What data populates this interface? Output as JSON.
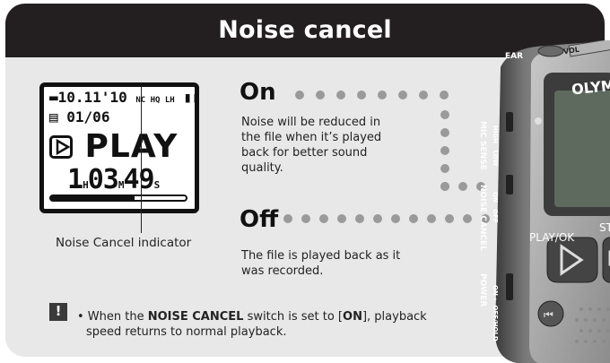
{
  "title": "Noise cancel",
  "display": {
    "date": "10.11'10",
    "status_icons": "NC HQ LH",
    "file_counter": "01/06",
    "mode": "PLAY",
    "time_h": "1",
    "time_h_unit": "H",
    "time_m": "03",
    "time_m_unit": "M",
    "time_s": "49",
    "time_s_unit": "S",
    "progress_fraction": 0.62
  },
  "indicator_label": "Noise Cancel indicator",
  "on_section": {
    "heading": "On",
    "description_lines": [
      "Noise will be reduced in",
      "the file when it’s played",
      "back for better sound",
      "quality."
    ]
  },
  "off_section": {
    "heading": "Off",
    "description_lines": [
      "The file is played back as it",
      "was recorded."
    ]
  },
  "note": {
    "icon": "!",
    "prefix": "• When the ",
    "switch_name": "NOISE CANCEL",
    "middle": " switch is set to [",
    "setting": "ON",
    "suffix_line1": "], playback",
    "line2": "speed returns to normal playback."
  },
  "device": {
    "brand_partial": "OLYM",
    "ear_label": "EAR",
    "vol_label": "VOL",
    "mic_sense_label": "MIC SENSE",
    "mic_sense_high": "HIGH",
    "mic_sense_low": "LOW",
    "noise_cancel_label": "NOISE CANCEL",
    "noise_cancel_on": "ON",
    "noise_cancel_off": "OFF",
    "power_label": "POWER",
    "power_positions": "ON ← OFF/HOLD",
    "play_ok_label": "PLAY/OK",
    "stop_partial": "ST"
  },
  "colors": {
    "banner": "#231f20",
    "panel": "#e8e8e8",
    "dots": "#9a9a9a",
    "device_body": "#5a5a5a"
  }
}
